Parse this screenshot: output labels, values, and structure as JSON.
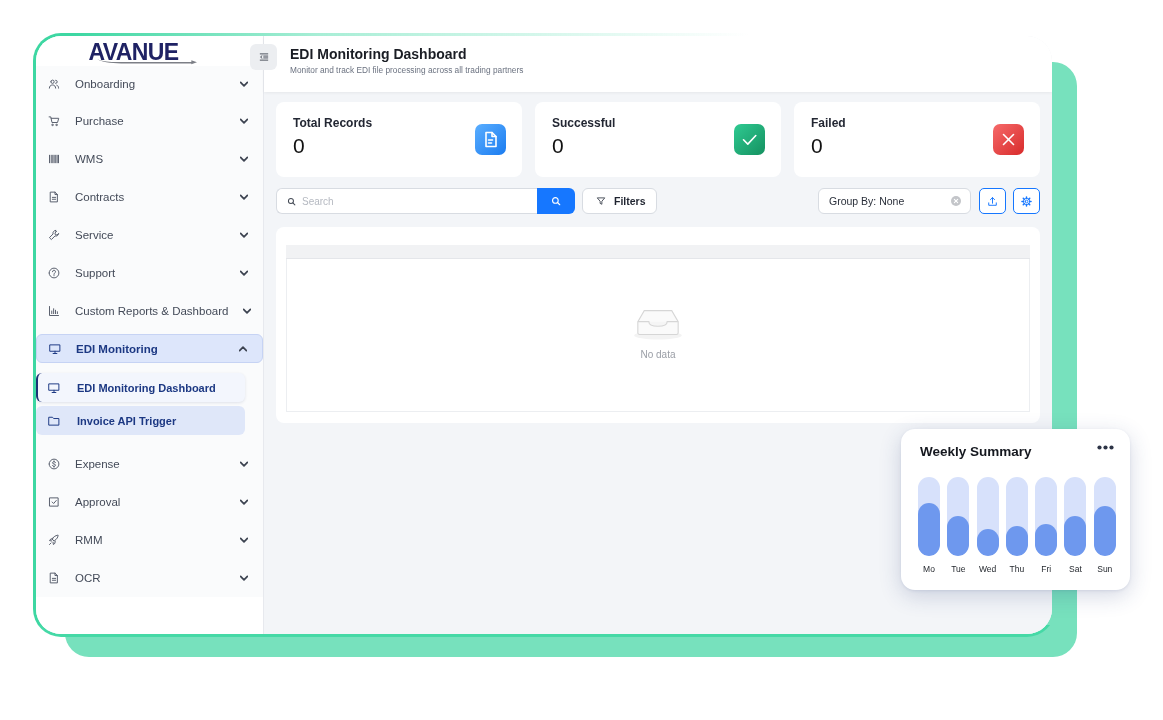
{
  "logo": {
    "text": "AVANUE"
  },
  "sidebar": {
    "items": [
      {
        "label": "Onboarding",
        "selected": false,
        "expanded": false
      },
      {
        "label": "Purchase",
        "selected": false,
        "expanded": false
      },
      {
        "label": "WMS",
        "selected": false,
        "expanded": false
      },
      {
        "label": "Contracts",
        "selected": false,
        "expanded": false
      },
      {
        "label": "Service",
        "selected": false,
        "expanded": false
      },
      {
        "label": "Support",
        "selected": false,
        "expanded": false
      },
      {
        "label": "Custom Reports & Dashboard",
        "selected": false,
        "expanded": false
      },
      {
        "label": "EDI Monitoring",
        "selected": true,
        "expanded": true,
        "children": [
          {
            "label": "EDI Monitoring Dashboard",
            "selected": true
          },
          {
            "label": "Invoice API Trigger",
            "selected": false
          }
        ]
      },
      {
        "label": "Expense",
        "selected": false,
        "expanded": false
      },
      {
        "label": "Approval",
        "selected": false,
        "expanded": false
      },
      {
        "label": "RMM",
        "selected": false,
        "expanded": false
      },
      {
        "label": "OCR",
        "selected": false,
        "expanded": false
      }
    ]
  },
  "header": {
    "title": "EDI Monitoring Dashboard",
    "subtitle": "Monitor and track EDI file processing across all trading partners"
  },
  "stats": [
    {
      "kind": "total",
      "label": "Total Records",
      "value": "0"
    },
    {
      "kind": "success",
      "label": "Successful",
      "value": "0"
    },
    {
      "kind": "failed",
      "label": "Failed",
      "value": "0"
    }
  ],
  "toolbar": {
    "search": {
      "placeholder": "Search"
    },
    "filters_button": "Filters",
    "group_by": {
      "value": "Group By: None"
    }
  },
  "table": {
    "empty_message": "No data"
  },
  "weekly_summary": {
    "title": "Weekly Summary",
    "days": [
      {
        "label": "Mo",
        "level": 0.67
      },
      {
        "label": "Tue",
        "level": 0.51
      },
      {
        "label": "Wed",
        "level": 0.34
      },
      {
        "label": "Thu",
        "level": 0.38
      },
      {
        "label": "Fri",
        "level": 0.4
      },
      {
        "label": "Sat",
        "level": 0.51
      },
      {
        "label": "Sun",
        "level": 0.63
      }
    ]
  }
}
